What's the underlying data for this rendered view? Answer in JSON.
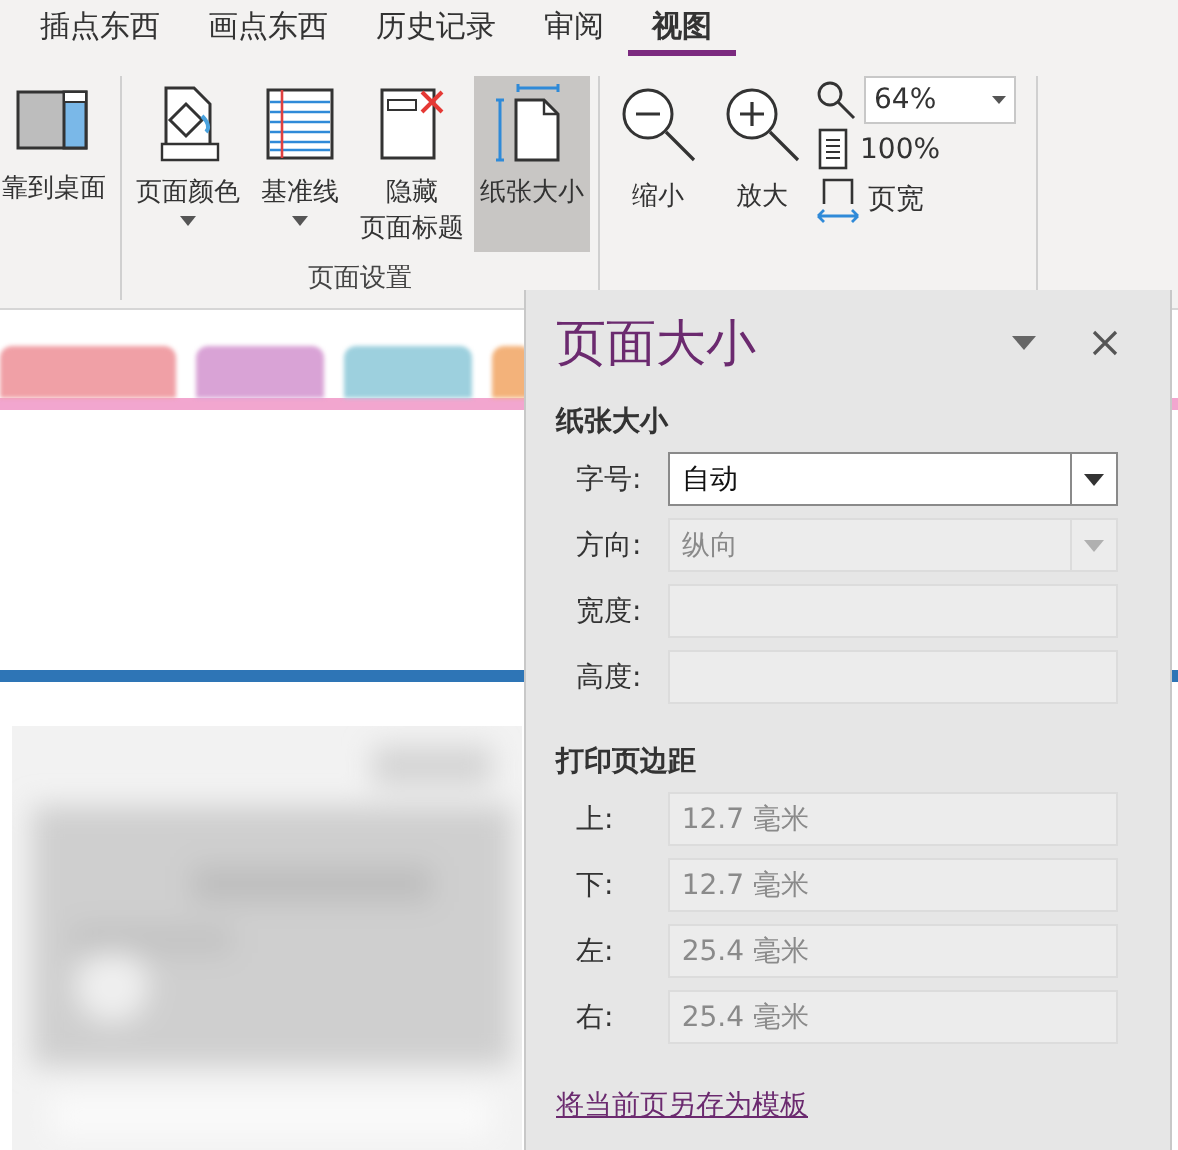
{
  "menu_tabs": [
    {
      "label": "插点东西",
      "selected": false
    },
    {
      "label": "画点东西",
      "selected": false
    },
    {
      "label": "历史记录",
      "selected": false
    },
    {
      "label": "审阅",
      "selected": false
    },
    {
      "label": "视图",
      "selected": true
    }
  ],
  "ribbon": {
    "dock_button": {
      "label": "靠到桌面"
    },
    "page_setup": {
      "label": "页面设置",
      "buttons": [
        {
          "kind": "color",
          "label": "页面颜色",
          "dropdown": true,
          "selected": false
        },
        {
          "kind": "lines",
          "label": "基准线",
          "dropdown": true,
          "selected": false
        },
        {
          "kind": "hide",
          "label_lines": [
            "隐藏",
            "页面标题"
          ],
          "dropdown": false,
          "selected": false
        },
        {
          "kind": "size",
          "label": "纸张大小",
          "dropdown": false,
          "selected": true
        }
      ]
    },
    "zoom": {
      "buttons": [
        {
          "kind": "out",
          "label": "缩小"
        },
        {
          "kind": "in",
          "label": "放大"
        }
      ],
      "zoom_value": "64%",
      "actual_size": "100%",
      "page_width": "页宽"
    }
  },
  "task_pane": {
    "title": "页面大小",
    "paper_section": "纸张大小",
    "paper_fields": [
      {
        "label": "字号:",
        "kind": "select",
        "value": "自动",
        "disabled": false
      },
      {
        "label": "方向:",
        "kind": "select",
        "value": "纵向",
        "disabled": true
      },
      {
        "label": "宽度:",
        "kind": "text",
        "disabled": true
      },
      {
        "label": "高度:",
        "kind": "text",
        "disabled": true
      }
    ],
    "margin_section": "打印页边距",
    "margin_fields": [
      {
        "label": "上:",
        "kind": "text",
        "value": "12.7 毫米",
        "disabled": true
      },
      {
        "label": "下:",
        "kind": "text",
        "value": "12.7 毫米",
        "disabled": true
      },
      {
        "label": "左:",
        "kind": "text",
        "value": "25.4 毫米",
        "disabled": true
      },
      {
        "label": "右:",
        "kind": "text",
        "value": "25.4 毫米",
        "disabled": true
      }
    ],
    "template_link": "将当前页另存为模板"
  }
}
